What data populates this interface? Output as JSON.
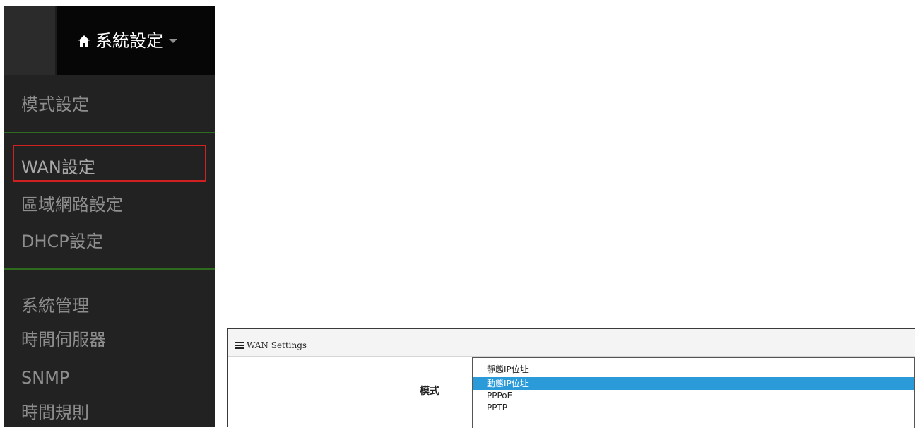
{
  "topbar": {
    "title": "系統設定",
    "home_icon": "home-icon",
    "caret_icon": "caret-down-icon"
  },
  "sidebar": {
    "items": [
      {
        "label": "模式設定"
      },
      {
        "label": "WAN設定",
        "active": true
      },
      {
        "label": "區域網路設定"
      },
      {
        "label": "DHCP設定"
      },
      {
        "label": "系統管理"
      },
      {
        "label": "時間伺服器"
      },
      {
        "label": "SNMP"
      },
      {
        "label": "時間規則"
      }
    ],
    "highlight_color": "#d21f1f",
    "divider_color": "#2f6b1e"
  },
  "panel": {
    "title": "WAN Settings",
    "title_icon": "list-icon",
    "mode_label": "模式",
    "dropdown": {
      "options": [
        "靜態IP位址",
        "動態IP位址",
        "PPPoE",
        "PPTP"
      ],
      "selected": "動態IP位址"
    },
    "selected_color": "#2b9ad8"
  }
}
